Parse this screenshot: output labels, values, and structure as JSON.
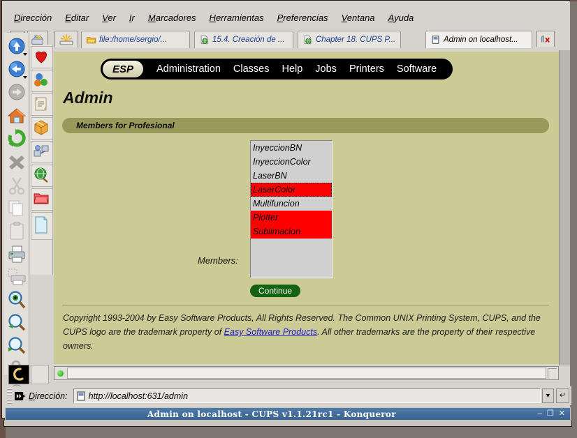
{
  "window": {
    "title": "Admin on localhost - CUPS v1.1.21rc1 - Konqueror",
    "buttons": {
      "minimize": "–",
      "maximize": "❐",
      "close": "✕"
    }
  },
  "menubar": {
    "items": [
      {
        "name": "direccion",
        "pre": "D",
        "post": "irección"
      },
      {
        "name": "editar",
        "pre": "E",
        "post": "ditar"
      },
      {
        "name": "ver",
        "pre": "V",
        "post": "er"
      },
      {
        "name": "ir",
        "pre": "I",
        "post": "r"
      },
      {
        "name": "marcadores",
        "pre": "M",
        "post": "arcadores"
      },
      {
        "name": "herramientas",
        "pre": "H",
        "post": "erramientas"
      },
      {
        "name": "preferencias",
        "pre": "P",
        "post": "referencias"
      },
      {
        "name": "ventana",
        "pre": "V",
        "post": "entana"
      },
      {
        "name": "ayuda",
        "pre": "A",
        "post": "yuda"
      }
    ]
  },
  "tabs": [
    {
      "label": "file:/home/sergio/...",
      "icon": "folder-icon",
      "active": false
    },
    {
      "label": "15.4. Creación de ...",
      "icon": "globe-page-icon",
      "active": false
    },
    {
      "label": "Chapter 18. CUPS P...",
      "icon": "globe-page-icon",
      "active": false
    },
    {
      "label": "Admin on localhost...",
      "icon": "page-icon",
      "active": true
    }
  ],
  "tab_close_label": "close-tab",
  "toolbar_left": {
    "icons": [
      "up-icon",
      "back-icon",
      "forward-icon",
      "home-icon",
      "reload-icon",
      "stop-icon",
      "cut-icon",
      "copy-icon",
      "paste-icon",
      "print-icon",
      "print-preview-icon",
      "find-icon",
      "zoom-in-icon",
      "zoom-out-icon",
      "security-lock-icon",
      "download-icon",
      "konqueror-logo-icon"
    ]
  },
  "toolbar_left2": {
    "icons": [
      "new-window-icon",
      "bookmarks-heart-icon",
      "plugins-icon",
      "history-scroll-icon",
      "package-icon",
      "network-icon",
      "web-globe-icon",
      "red-folder-icon",
      "blank-page-icon"
    ]
  },
  "page": {
    "nav": {
      "brand": "ESP",
      "links": [
        "Administration",
        "Classes",
        "Help",
        "Jobs",
        "Printers",
        "Software"
      ]
    },
    "title": "Admin",
    "section_title": "Members for Profesional",
    "form": {
      "members_label": "Members:",
      "members": [
        {
          "label": "InyeccionBN",
          "selected": false,
          "focused": false
        },
        {
          "label": "InyeccionColor",
          "selected": false,
          "focused": false
        },
        {
          "label": "LaserBN",
          "selected": false,
          "focused": false
        },
        {
          "label": "LaserColor",
          "selected": true,
          "focused": true
        },
        {
          "label": "Multifuncion",
          "selected": false,
          "focused": false
        },
        {
          "label": "Plotter",
          "selected": true,
          "focused": false
        },
        {
          "label": "Sublimacion",
          "selected": true,
          "focused": false
        }
      ],
      "continue_label": "Continue"
    },
    "footer": {
      "part1": "Copyright 1993-2004 by Easy Software Products, All Rights Reserved. The Common UNIX Printing System, CUPS, and the CUPS logo are the trademark property of ",
      "link": "Easy Software Products",
      "part2": ". All other trademarks are the property of their respective owners."
    }
  },
  "statusbar": {
    "text": "",
    "led": "ready-green"
  },
  "addressbar": {
    "label_pre": "D",
    "label_post": "irección:",
    "url": "http://localhost:631/admin",
    "dropdown_glyph": "▼",
    "go_glyph": "↵"
  },
  "colors": {
    "page_bg": "#cccb95",
    "section_bar": "#99995c",
    "selection_red": "#ff0000",
    "button_green": "#136312",
    "link_blue": "#2020d0",
    "titlebar_blue": "#3f6b99"
  }
}
